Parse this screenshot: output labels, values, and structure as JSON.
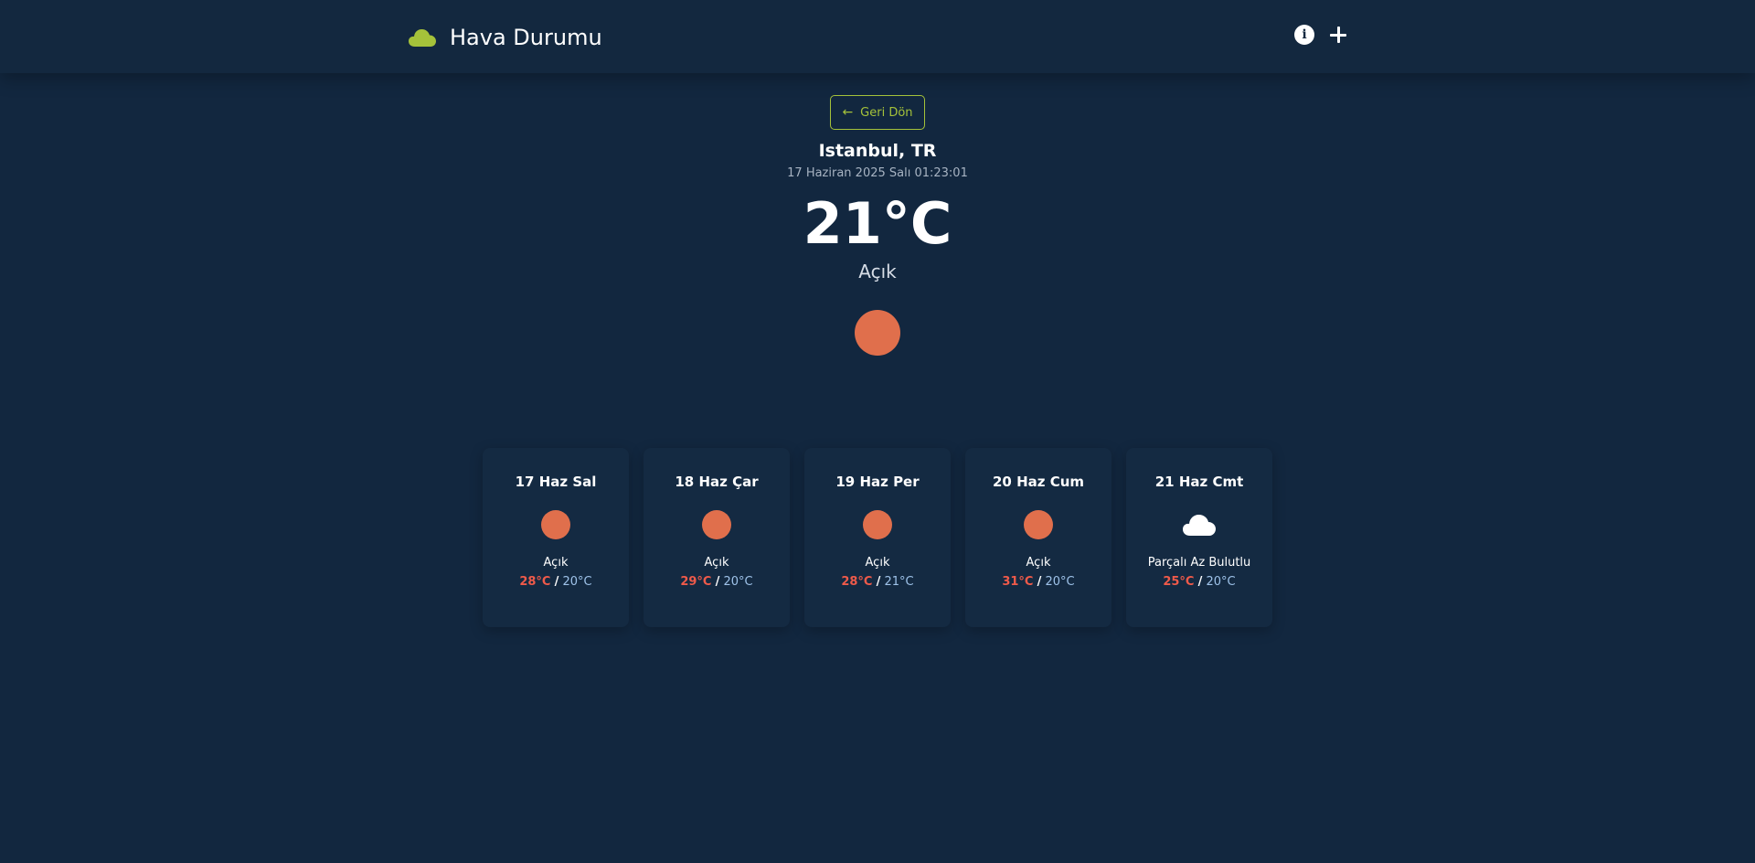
{
  "header": {
    "brand_icon": "cloud-icon",
    "brand_color": "#a5c23a",
    "title": "Hava Durumu",
    "info_icon": "info-icon",
    "info_glyph": "i",
    "add_icon": "plus-icon"
  },
  "current": {
    "back_label": "Geri Dön",
    "back_icon": "arrow-left-icon",
    "back_glyph": "←",
    "city": "Istanbul, TR",
    "datetime": "17 Haziran 2025 Salı 01:23:01",
    "temperature": "21°C",
    "description": "Açık",
    "icon": "sun-icon",
    "sun_color": "#e06f4c"
  },
  "forecast": [
    {
      "day": "17 Haz Sal",
      "icon": "sun-icon",
      "description": "Açık",
      "max": "28°C",
      "min": "20°C"
    },
    {
      "day": "18 Haz Çar",
      "icon": "sun-icon",
      "description": "Açık",
      "max": "29°C",
      "min": "20°C"
    },
    {
      "day": "19 Haz Per",
      "icon": "sun-icon",
      "description": "Açık",
      "max": "28°C",
      "min": "21°C"
    },
    {
      "day": "20 Haz Cum",
      "icon": "sun-icon",
      "description": "Açık",
      "max": "31°C",
      "min": "20°C"
    },
    {
      "day": "21 Haz Cmt",
      "icon": "cloud-icon",
      "description": "Parçalı Az Bulutlu",
      "max": "25°C",
      "min": "20°C"
    }
  ],
  "temp_separator": "/",
  "colors": {
    "background": "#12273f",
    "max_temp": "#ef5a4a",
    "min_temp": "#9fc3ea"
  }
}
